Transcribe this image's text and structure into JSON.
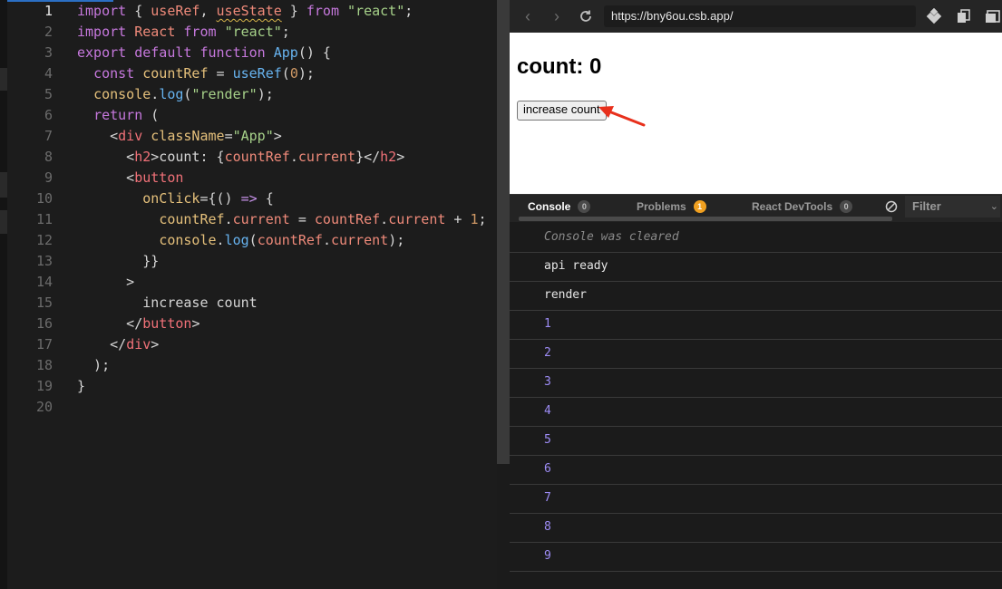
{
  "editor": {
    "lines": [
      {
        "n": "1",
        "segs": [
          [
            "kw",
            "import"
          ],
          [
            "plain",
            " { "
          ],
          [
            "var",
            "useRef"
          ],
          [
            "plain",
            ", "
          ],
          [
            "var squig",
            "useState"
          ],
          [
            "plain",
            " } "
          ],
          [
            "kw",
            "from"
          ],
          [
            "plain",
            " "
          ],
          [
            "str",
            "\"react\""
          ],
          [
            "plain",
            ";"
          ]
        ]
      },
      {
        "n": "2",
        "segs": [
          [
            "kw",
            "import"
          ],
          [
            "plain",
            " "
          ],
          [
            "var",
            "React"
          ],
          [
            "plain",
            " "
          ],
          [
            "kw",
            "from"
          ],
          [
            "plain",
            " "
          ],
          [
            "str",
            "\"react\""
          ],
          [
            "plain",
            ";"
          ]
        ]
      },
      {
        "n": "3",
        "segs": [
          [
            "kw",
            "export"
          ],
          [
            "plain",
            " "
          ],
          [
            "kw",
            "default"
          ],
          [
            "plain",
            " "
          ],
          [
            "kw",
            "function"
          ],
          [
            "plain",
            " "
          ],
          [
            "fn",
            "App"
          ],
          [
            "plain",
            "() {"
          ]
        ]
      },
      {
        "n": "4",
        "segs": [
          [
            "plain",
            "  "
          ],
          [
            "kw",
            "const"
          ],
          [
            "plain",
            " "
          ],
          [
            "attr",
            "countRef"
          ],
          [
            "plain",
            " = "
          ],
          [
            "fn",
            "useRef"
          ],
          [
            "plain",
            "("
          ],
          [
            "num",
            "0"
          ],
          [
            "plain",
            ");"
          ]
        ]
      },
      {
        "n": "5",
        "segs": [
          [
            "plain",
            "  "
          ],
          [
            "attr",
            "console"
          ],
          [
            "plain",
            "."
          ],
          [
            "fn",
            "log"
          ],
          [
            "plain",
            "("
          ],
          [
            "str",
            "\"render\""
          ],
          [
            "plain",
            ");"
          ]
        ]
      },
      {
        "n": "6",
        "segs": [
          [
            "plain",
            "  "
          ],
          [
            "kw",
            "return"
          ],
          [
            "plain",
            " ("
          ]
        ]
      },
      {
        "n": "7",
        "segs": [
          [
            "plain",
            "    <"
          ],
          [
            "tag",
            "div"
          ],
          [
            "plain",
            " "
          ],
          [
            "attr",
            "className"
          ],
          [
            "plain",
            "="
          ],
          [
            "str",
            "\"App\""
          ],
          [
            "plain",
            ">"
          ]
        ]
      },
      {
        "n": "8",
        "segs": [
          [
            "plain",
            "      <"
          ],
          [
            "tag",
            "h2"
          ],
          [
            "plain",
            ">count: {"
          ],
          [
            "var",
            "countRef"
          ],
          [
            "plain",
            "."
          ],
          [
            "var",
            "current"
          ],
          [
            "plain",
            "}</"
          ],
          [
            "tag",
            "h2"
          ],
          [
            "plain",
            ">"
          ]
        ]
      },
      {
        "n": "9",
        "segs": [
          [
            "plain",
            "      <"
          ],
          [
            "tag",
            "button"
          ]
        ]
      },
      {
        "n": "10",
        "segs": [
          [
            "plain",
            "        "
          ],
          [
            "attr",
            "onClick"
          ],
          [
            "plain",
            "={() "
          ],
          [
            "op",
            "=>"
          ],
          [
            "plain",
            " {"
          ]
        ]
      },
      {
        "n": "11",
        "segs": [
          [
            "plain",
            "          "
          ],
          [
            "attr",
            "countRef"
          ],
          [
            "plain",
            "."
          ],
          [
            "var",
            "current"
          ],
          [
            "plain",
            " = "
          ],
          [
            "var",
            "countRef"
          ],
          [
            "plain",
            "."
          ],
          [
            "var",
            "current"
          ],
          [
            "plain",
            " + "
          ],
          [
            "num",
            "1"
          ],
          [
            "plain",
            ";"
          ]
        ]
      },
      {
        "n": "12",
        "segs": [
          [
            "plain",
            "          "
          ],
          [
            "attr",
            "console"
          ],
          [
            "plain",
            "."
          ],
          [
            "fn",
            "log"
          ],
          [
            "plain",
            "("
          ],
          [
            "var",
            "countRef"
          ],
          [
            "plain",
            "."
          ],
          [
            "var",
            "current"
          ],
          [
            "plain",
            ");"
          ]
        ]
      },
      {
        "n": "13",
        "segs": [
          [
            "plain",
            "        }}"
          ]
        ]
      },
      {
        "n": "14",
        "segs": [
          [
            "plain",
            "      >"
          ]
        ]
      },
      {
        "n": "15",
        "segs": [
          [
            "plain",
            "        increase count"
          ]
        ]
      },
      {
        "n": "16",
        "segs": [
          [
            "plain",
            "      </"
          ],
          [
            "tag",
            "button"
          ],
          [
            "plain",
            ">"
          ]
        ]
      },
      {
        "n": "17",
        "segs": [
          [
            "plain",
            "    </"
          ],
          [
            "tag",
            "div"
          ],
          [
            "plain",
            ">"
          ]
        ]
      },
      {
        "n": "18",
        "segs": [
          [
            "plain",
            "  );"
          ]
        ]
      },
      {
        "n": "19",
        "segs": [
          [
            "plain",
            "}"
          ]
        ]
      },
      {
        "n": "20",
        "segs": []
      }
    ]
  },
  "browser": {
    "url": "https://bny6ou.csb.app/",
    "heading": "count: 0",
    "button_label": "increase count"
  },
  "panel": {
    "tabs": [
      {
        "label": "Console",
        "badge": "0",
        "badge_style": "gray"
      },
      {
        "label": "Problems",
        "badge": "1",
        "badge_style": "orange"
      },
      {
        "label": "React DevTools",
        "badge": "0",
        "badge_style": "gray"
      }
    ],
    "filter_placeholder": "Filter"
  },
  "console": {
    "entries": [
      {
        "text": "Console was cleared",
        "kind": "cleared"
      },
      {
        "text": "api ready",
        "kind": "log"
      },
      {
        "text": "render",
        "kind": "log"
      },
      {
        "text": "1",
        "kind": "numv"
      },
      {
        "text": "2",
        "kind": "numv"
      },
      {
        "text": "3",
        "kind": "numv"
      },
      {
        "text": "4",
        "kind": "numv"
      },
      {
        "text": "5",
        "kind": "numv"
      },
      {
        "text": "6",
        "kind": "numv"
      },
      {
        "text": "7",
        "kind": "numv"
      },
      {
        "text": "8",
        "kind": "numv"
      },
      {
        "text": "9",
        "kind": "numv"
      }
    ]
  },
  "colors": {
    "annotation_arrow": "#e8301c",
    "accent": "#2b6fc4"
  }
}
